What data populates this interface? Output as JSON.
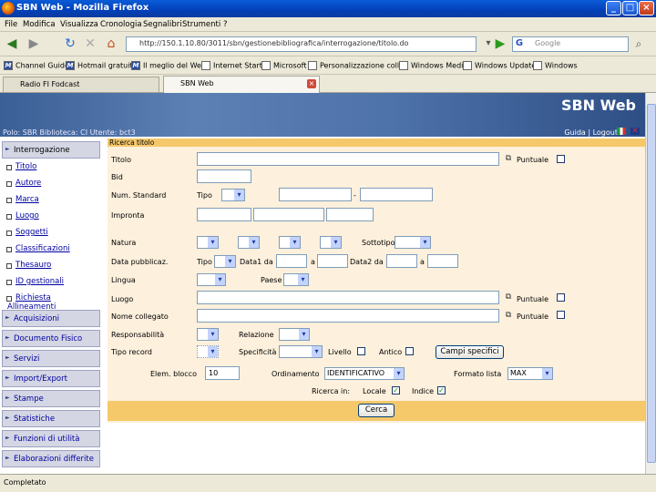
{
  "window": {
    "title": "SBN Web - Mozilla Firefox"
  },
  "menu": [
    "File",
    "Modifica",
    "Visualizza",
    "Cronologia",
    "Segnalibri",
    "Strumenti",
    "?"
  ],
  "nav": {
    "url": "http://150.1.10.80/3011/sbn/gestionebibliografica/interrogazione/titolo.do",
    "search_placeholder": "Google"
  },
  "bookmarks": [
    "Channel Guide",
    "Hotmail gratuita",
    "Il meglio del Web",
    "Internet Start",
    "Microsoft",
    "Personalizzazione coll.",
    "Windows Media",
    "Windows Update",
    "Windows"
  ],
  "tabs": [
    {
      "label": "Radio FI Fodcast"
    },
    {
      "label": "SBN Web"
    }
  ],
  "header": {
    "title": "SBN Web",
    "polo": "Polo: SBR Biblioteca: CI Utente: bct3",
    "links": "Guida | Logout"
  },
  "sidebar": {
    "sections": [
      {
        "label": "Interrogazione"
      },
      {
        "label": "Acquisizioni"
      },
      {
        "label": "Documento Fisico"
      },
      {
        "label": "Servizi"
      },
      {
        "label": "Import/Export"
      },
      {
        "label": "Stampe"
      },
      {
        "label": "Statistiche"
      },
      {
        "label": "Funzioni di utilità"
      },
      {
        "label": "Elaborazioni differite"
      }
    ],
    "items": [
      "Titolo",
      "Autore",
      "Marca",
      "Luogo",
      "Soggetti",
      "Classificazioni",
      "Thesauro",
      "ID gestionali",
      "Richiesta Allineamenti"
    ]
  },
  "form": {
    "heading": "Ricerca titolo",
    "titolo": "Titolo",
    "bid": "Bid",
    "num_standard": "Num. Standard",
    "tipo": "Tipo",
    "impronta": "Impronta",
    "natura": "Natura",
    "sottotipo": "Sottotipo",
    "data_pubblicazione": "Data pubblicaz.",
    "data1_da": "Data1 da",
    "a": "a",
    "data2_da": "Data2 da",
    "lingua": "Lingua",
    "paese": "Paese",
    "luogo": "Luogo",
    "nome_collegato": "Nome collegato",
    "responsabilita": "Responsabilità",
    "relazione": "Relazione",
    "tipo_record": "Tipo record",
    "specificita": "Specificità",
    "livello": "Livello",
    "antico": "Antico",
    "campi_specifici": "Campi specifici",
    "elem_blocco": "Elem. blocco",
    "elem_blocco_value": "10",
    "ordinamento": "Ordinamento",
    "ordinamento_value": "IDENTIFICATIVO",
    "formato_lista": "Formato lista",
    "formato_lista_value": "MAX",
    "puntuale": "Puntuale",
    "ricerca_in": "Ricerca in:",
    "locale": "Locale",
    "indice": "Indice",
    "cerca": "Cerca"
  },
  "status": {
    "text": "Completato"
  }
}
